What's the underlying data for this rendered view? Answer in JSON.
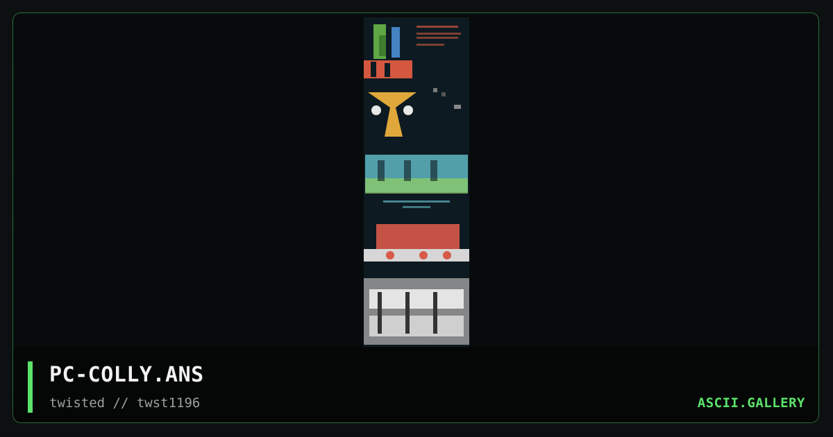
{
  "artwork": {
    "title": "PC-COLLY.ANS",
    "credit": "twisted // twst1196"
  },
  "brand": {
    "site": "ASCII.GALLERY"
  },
  "colors": {
    "accent": "#5de36b",
    "frame_border": "#2f6b38",
    "background": "#080b0b",
    "footer_background": "#050707",
    "title_text": "#f2f2f2",
    "subtitle_text": "#9aa29c"
  }
}
